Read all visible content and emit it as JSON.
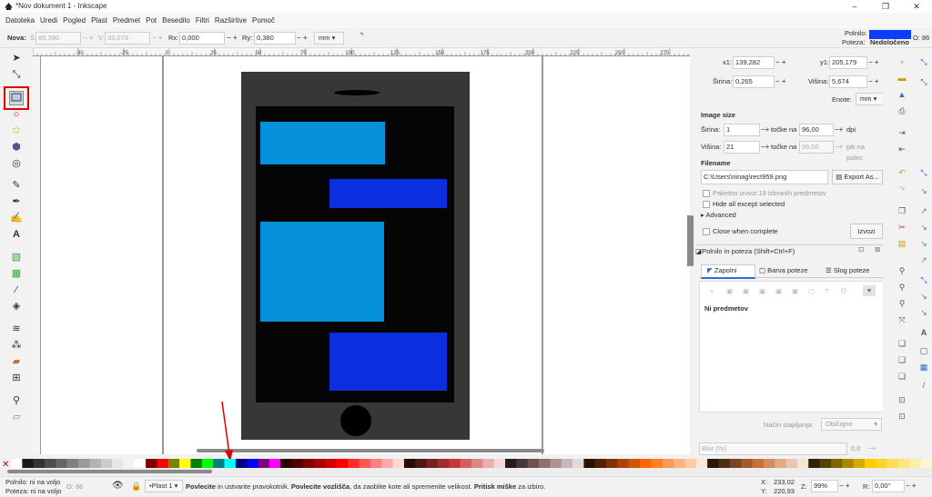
{
  "window": {
    "title": "*Nov dokument 1 - Inkscape",
    "minimize": "–",
    "maximize": "❐",
    "close": "✕"
  },
  "menu": [
    "Datoteka",
    "Uredi",
    "Pogled",
    "Plast",
    "Predmet",
    "Pot",
    "Besedilo",
    "Filtri",
    "Razširitve",
    "Pomoč"
  ],
  "toolbar": {
    "mode_label": "Nova:",
    "w_label": "Š:",
    "w_value": "65,390",
    "h_label": "V:",
    "h_value": "33,073",
    "rx_label": "Rx:",
    "rx_value": "0,000",
    "ry_label": "Ry:",
    "ry_value": "0,380",
    "unit": "mm",
    "fill_label": "Polnilo:",
    "stroke_label": "Poteza:",
    "stroke_value": "Nedoločeno",
    "opacity_label": "O:",
    "opacity_value": "86"
  },
  "tool_icons": [
    "selector-tool",
    "node-tool",
    "rect-tool",
    "ellipse-tool",
    "star-tool",
    "box3d-tool",
    "spiral-tool",
    "pencil-tool",
    "pen-tool",
    "calligraphy-tool",
    "text-tool",
    "gradient-tool",
    "mesh-tool",
    "dropper-tool",
    "paint-bucket-tool",
    "tweak-tool",
    "spray-tool",
    "eraser-tool",
    "connector-tool",
    "zoom-tool",
    "measure-tool"
  ],
  "export": {
    "x1_label": "x1:",
    "x1_value": "139,282",
    "y1_label": "y1:",
    "y1_value": "205,179",
    "w_label": "Širina:",
    "w_value": "0,265",
    "h_label": "Višina:",
    "h_value": "5,674",
    "units_label": "Enote:",
    "units_value": "mm",
    "image_size_title": "Image size",
    "img_w_label": "Širina:",
    "img_w_value": "1",
    "dots_label": "točke na",
    "dpi_value": "96,00",
    "dpi_label": "dpi",
    "img_h_label": "Višina:",
    "img_h_value": "21",
    "dots_label2": "točke na",
    "dpi_value2": "96,00",
    "ppi_label": "pik na palec",
    "filename_title": "Filename",
    "filename_value": "C:\\Users\\ninag\\rect959.png",
    "export_as": "Export As...",
    "batch": "Paketno izvozi 19 izbranih predmetov",
    "hide": "Hide all except selected",
    "advanced": "Advanced",
    "close_when": "Close when complete",
    "export_btn": "Izvozi"
  },
  "fillstroke": {
    "title": "Polnilo in poteza",
    "shortcut": "(Shift+Ctrl+F)",
    "tabs": [
      "Zapolni",
      "Barva poteze",
      "Slog poteze"
    ],
    "empty": "Ni predmetov",
    "blend_label": "Način stapljanja:",
    "blend_value": "Običajno",
    "blur_label": "Blur (%)",
    "blur_value": "0,0"
  },
  "status": {
    "fill": "Polnilo: ni na voljo",
    "stroke": "Poteza: ni na voljo",
    "o_label": "O:",
    "o_value": "86",
    "layer": "•Plast 1",
    "message_b1": "Povlecite",
    "message_t1": " in ustvarite pravokotnik. ",
    "message_b2": "Povlecite vozlišča",
    "message_t2": ", da zaoblite kote ali spremenite velikost. ",
    "message_b3": "Pritisk miške",
    "message_t3": " za izbiro.",
    "x_label": "X:",
    "x_value": "233,02",
    "y_label": "Y:",
    "y_value": "220,93",
    "z_label": "Z:",
    "z_value": "99%",
    "r_label": "R:",
    "r_value": "0,00°"
  },
  "ruler_ticks": [
    "-30",
    "-25",
    "0",
    "25",
    "50",
    "75",
    "100",
    "125",
    "150",
    "175",
    "200",
    "225",
    "250",
    "275"
  ],
  "colors": {
    "accent_fill": "#0a3bff",
    "highlight": "#e00000"
  }
}
